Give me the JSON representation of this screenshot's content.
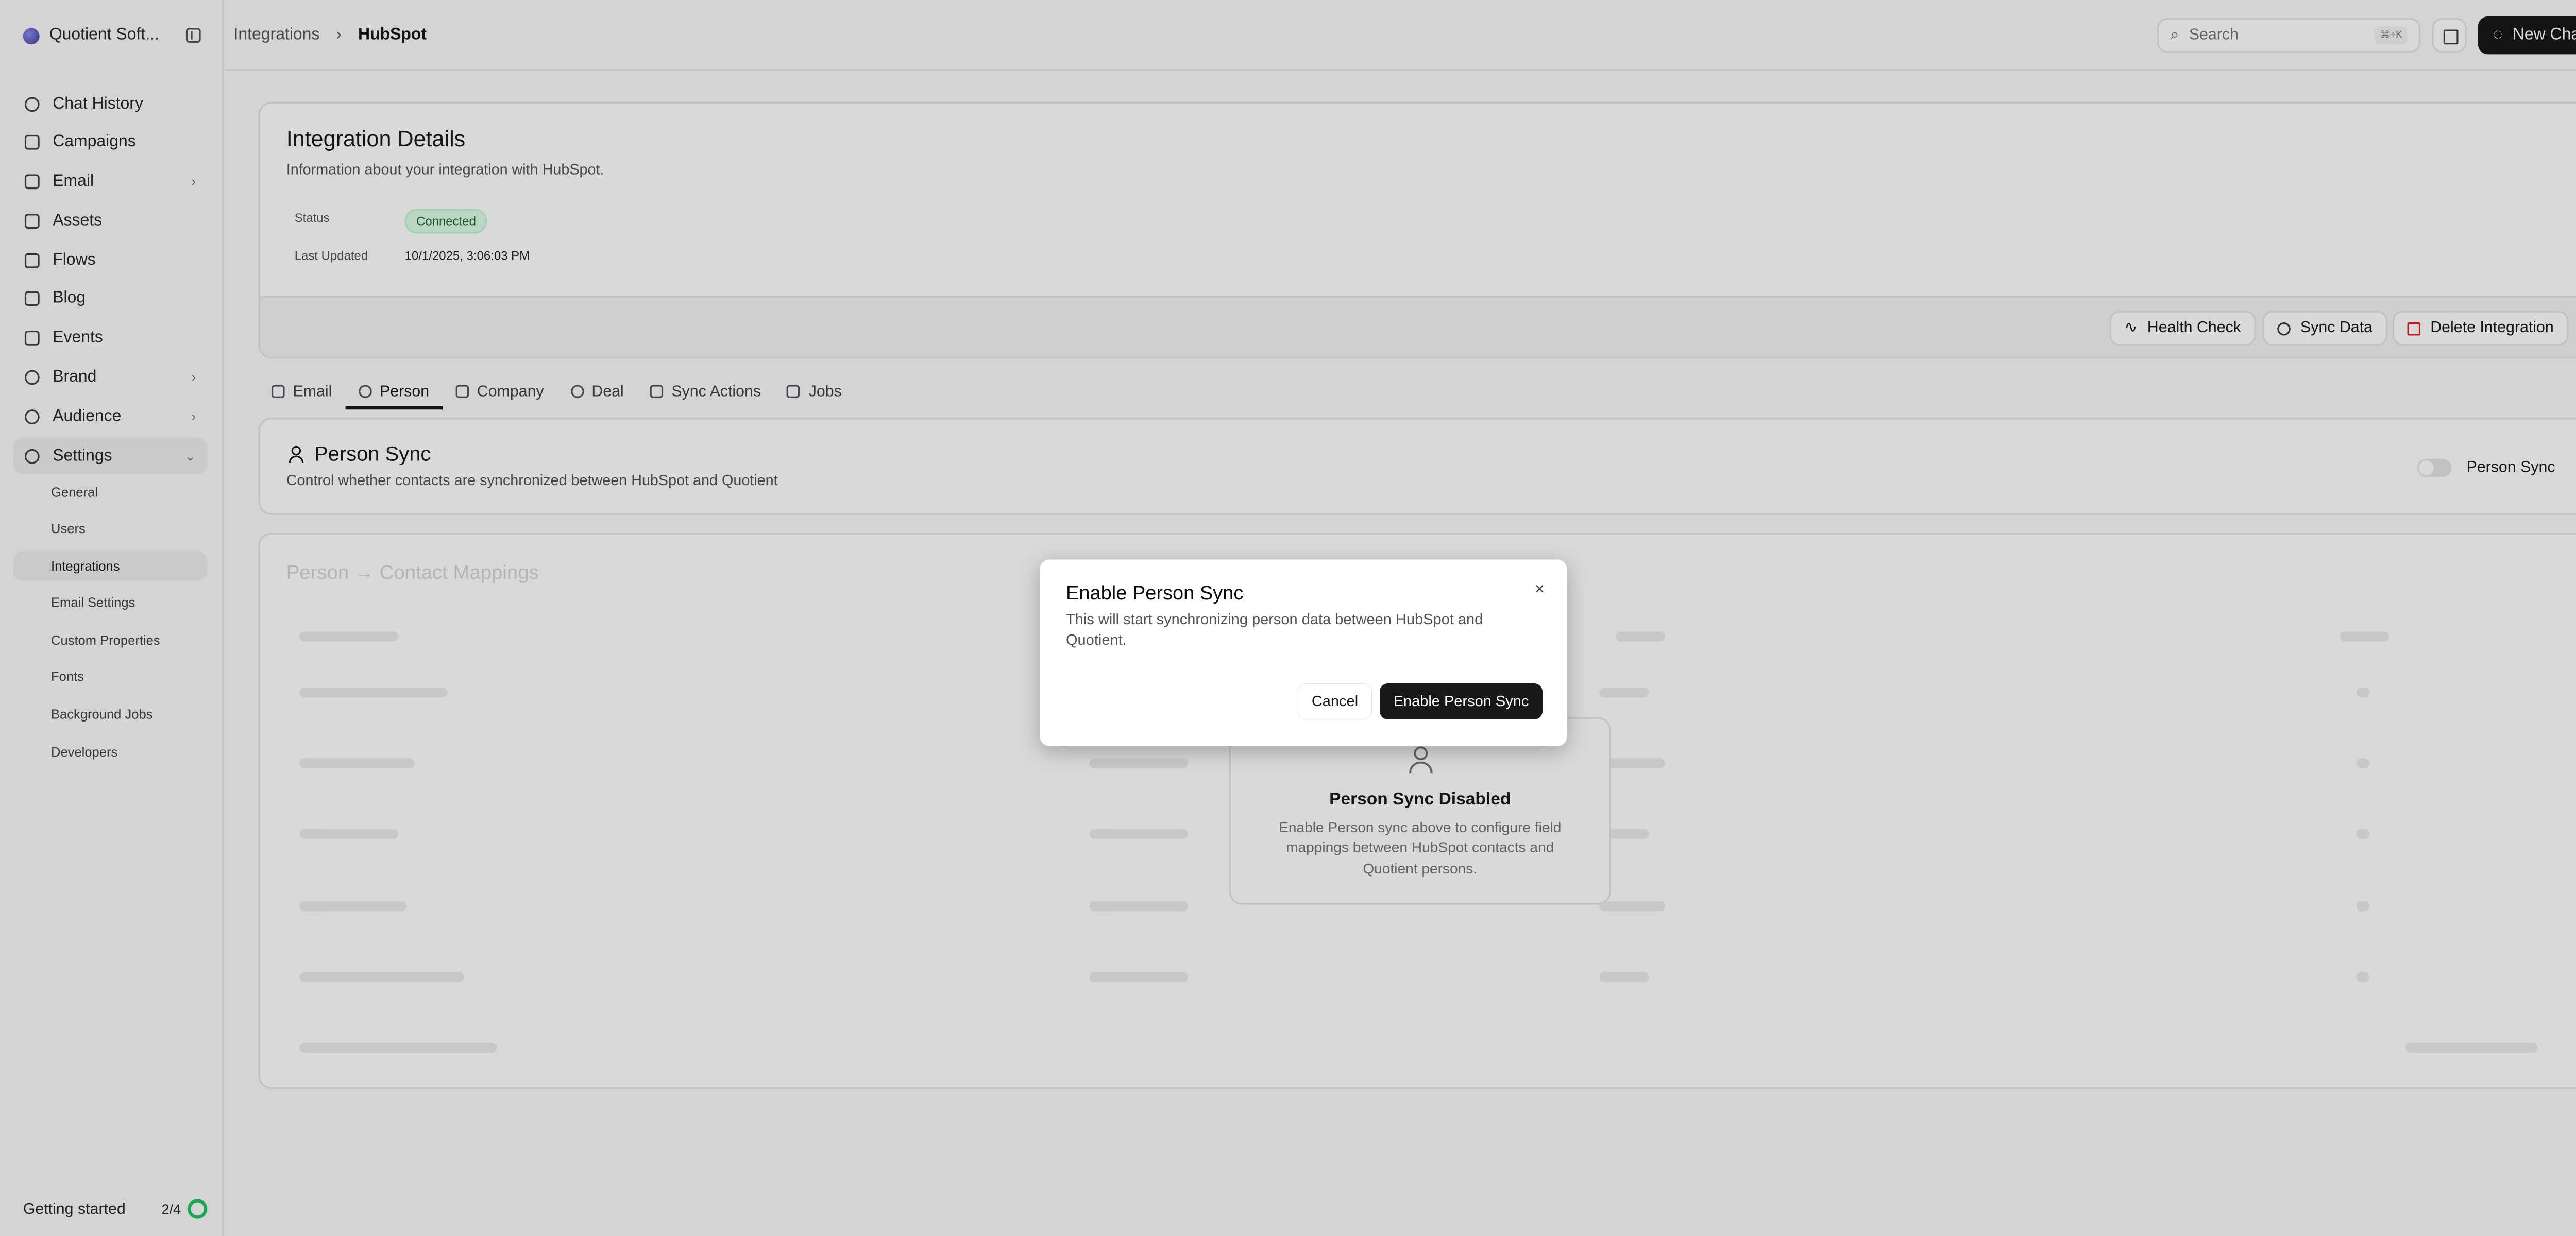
{
  "workspace": {
    "name": "Quotient Soft..."
  },
  "sidebar": {
    "items": [
      {
        "label": "Chat History",
        "icon": "history-icon"
      },
      {
        "label": "Campaigns",
        "icon": "calendar-icon"
      },
      {
        "label": "Email",
        "icon": "mail-icon",
        "chevron": "›"
      },
      {
        "label": "Assets",
        "icon": "image-icon"
      },
      {
        "label": "Flows",
        "icon": "flow-icon"
      },
      {
        "label": "Blog",
        "icon": "book-icon"
      },
      {
        "label": "Events",
        "icon": "calendar-icon"
      },
      {
        "label": "Brand",
        "icon": "palette-icon",
        "chevron": "›"
      },
      {
        "label": "Audience",
        "icon": "users-icon",
        "chevron": "›"
      },
      {
        "label": "Settings",
        "icon": "gear-icon",
        "chevron": "⌄"
      }
    ],
    "settings_sub": [
      "General",
      "Users",
      "Integrations",
      "Email Settings",
      "Custom Properties",
      "Fonts",
      "Background Jobs",
      "Developers"
    ],
    "getting_started": {
      "label": "Getting started",
      "progress": "2/4"
    }
  },
  "topbar": {
    "breadcrumb": [
      "Integrations",
      "HubSpot"
    ],
    "search_placeholder": "Search",
    "search_shortcut": "⌘+K",
    "new_chat": "New Chat"
  },
  "details": {
    "title": "Integration Details",
    "description": "Information about your integration with HubSpot.",
    "status_label": "Status",
    "status_value": "Connected",
    "updated_label": "Last Updated",
    "updated_value": "10/1/2025, 3:06:03 PM",
    "buttons": {
      "health": "Health Check",
      "sync": "Sync Data",
      "delete": "Delete Integration"
    }
  },
  "tabs": [
    "Email",
    "Person",
    "Company",
    "Deal",
    "Sync Actions",
    "Jobs"
  ],
  "person_sync": {
    "title": "Person Sync",
    "description": "Control whether contacts are synchronized between HubSpot and Quotient",
    "toggle_label": "Person Sync"
  },
  "mappings": {
    "title": "Person → Contact Mappings",
    "disabled_title": "Person Sync Disabled",
    "disabled_desc": "Enable Person sync above to configure field mappings between HubSpot contacts and Quotient persons."
  },
  "dialog": {
    "title": "Enable Person Sync",
    "description": "This will start synchronizing person data between HubSpot and Quotient.",
    "cancel": "Cancel",
    "confirm": "Enable Person Sync",
    "close": "×"
  },
  "colors": {
    "accent": "#18181b",
    "success_bg": "#dcfce7",
    "success_text": "#166534",
    "danger": "#dc2626"
  }
}
